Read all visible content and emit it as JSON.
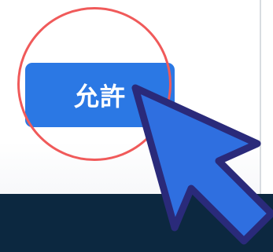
{
  "dialog": {
    "allow_button_label": "允許"
  },
  "annotation": {
    "highlight_color": "#f05a5a",
    "cursor_fill": "#2f6fe0",
    "cursor_outline": "#2a2a7a"
  },
  "icons": {
    "cursor": "mouse-pointer-arrow-icon"
  }
}
